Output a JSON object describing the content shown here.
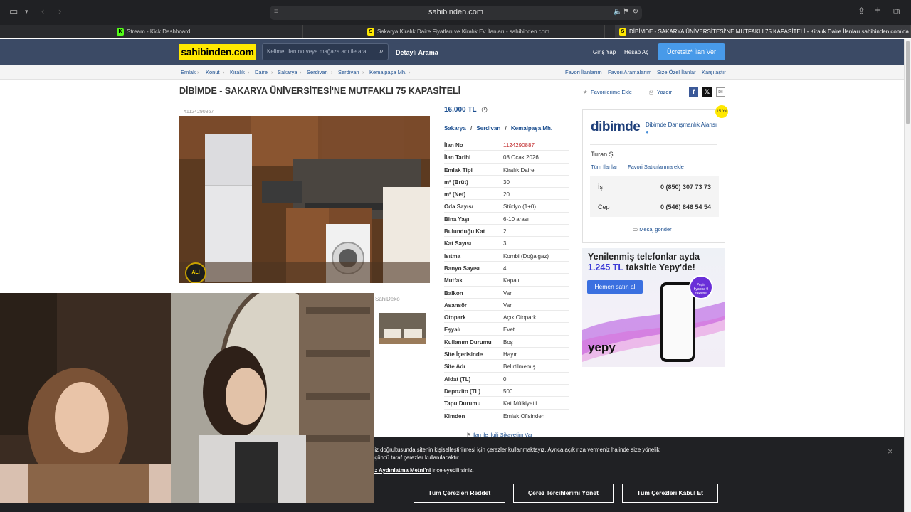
{
  "browser": {
    "url": "sahibinden.com",
    "tabs": [
      {
        "label": "Stream - Kick Dashboard",
        "favicon": "K"
      },
      {
        "label": "Sakarya Kiralık Daire Fiyatları ve Kiralık Ev İlanları - sahibinden.com",
        "favicon": "S"
      },
      {
        "label": "DİBİMDE - SAKARYA ÜNİVERSİTESİ'NE MUTFAKLI 75 KAPASİTELİ - Kiralık Daire İlanları sahibinden.com'da - 1124...",
        "favicon": "S"
      }
    ],
    "icons": [
      "sidebar-icon",
      "back-icon",
      "forward-icon",
      "share-icon",
      "new-tab-icon",
      "tabs-icon"
    ]
  },
  "header": {
    "logo": "sahibinden.com",
    "search_placeholder": "Kelime, ilan no veya mağaza adı ile ara",
    "detailed_search": "Detaylı Arama",
    "login": "Giriş Yap",
    "register": "Hesap Aç",
    "post_ad": "Ücretsiz* İlan Ver"
  },
  "breadcrumb": {
    "items": [
      "Emlak",
      "Konut",
      "Kiralık",
      "Daire",
      "Sakarya",
      "Serdivan",
      "Serdivan",
      "Kemalpaşa Mh."
    ],
    "right_links": [
      "Favori İlanlarım",
      "Favori Aramalarım",
      "Size Özel İlanlar",
      "Karşılaştır"
    ]
  },
  "listing": {
    "title": "DİBİMDE - SAKARYA ÜNİVERSİTESİ'NE MUTFAKLI 75 KAPASİTELİ",
    "add_favorite": "Favorilerime Ekle",
    "print": "Yazdır",
    "photo_id": "#1124290867",
    "price": "16.000 TL",
    "location": {
      "city": "Sakarya",
      "district": "Serdivan",
      "neighborhood": "Kemalpaşa Mh."
    },
    "properties": [
      {
        "key": "İlan No",
        "value": "1124290887"
      },
      {
        "key": "İlan Tarihi",
        "value": "08 Ocak 2026"
      },
      {
        "key": "Emlak Tipi",
        "value": "Kiralık Daire"
      },
      {
        "key": "m² (Brüt)",
        "value": "30"
      },
      {
        "key": "m² (Net)",
        "value": "20"
      },
      {
        "key": "Oda Sayısı",
        "value": "Stüdyo (1+0)"
      },
      {
        "key": "Bina Yaşı",
        "value": "6-10 arası"
      },
      {
        "key": "Bulunduğu Kat",
        "value": "2"
      },
      {
        "key": "Kat Sayısı",
        "value": "3"
      },
      {
        "key": "Isıtma",
        "value": "Kombi (Doğalgaz)"
      },
      {
        "key": "Banyo Sayısı",
        "value": "4"
      },
      {
        "key": "Mutfak",
        "value": "Kapalı"
      },
      {
        "key": "Balkon",
        "value": "Var"
      },
      {
        "key": "Asansör",
        "value": "Var"
      },
      {
        "key": "Otopark",
        "value": "Açık Otopark"
      },
      {
        "key": "Eşyalı",
        "value": "Evet"
      },
      {
        "key": "Kullanım Durumu",
        "value": "Boş"
      },
      {
        "key": "Site İçerisinde",
        "value": "Hayır"
      },
      {
        "key": "Site Adı",
        "value": "Belirtilmemiş"
      },
      {
        "key": "Aidat (TL)",
        "value": "0"
      },
      {
        "key": "Depozito (TL)",
        "value": "500"
      },
      {
        "key": "Tapu Durumu",
        "value": "Kat Mülkiyetli"
      },
      {
        "key": "Kimden",
        "value": "Emlak Ofisinden"
      }
    ],
    "report": "İlan ile İlgili Şikayetim Var",
    "sahideko": "SahiDeko"
  },
  "seller": {
    "badge": "15 Yıl",
    "brand": "dibimde",
    "agency": "Dibimde Danışmanlık Ajansı",
    "person": "Turan Ş.",
    "all_ads": "Tüm İlanları",
    "add_fav_seller": "Favori Satıcılarıma ekle",
    "phones": [
      {
        "label": "İş",
        "number": "0 (850) 307 73 73"
      },
      {
        "label": "Cep",
        "number": "0 (546) 846 54 54"
      }
    ],
    "message": "Mesaj gönder"
  },
  "ad": {
    "line1": "Yenilenmiş telefonlar ayda",
    "line2_amount": "1.245 TL",
    "line2_rest": "taksitle Yepy'de!",
    "button": "Hemen satın al",
    "brand": "yepy",
    "badge": "Peşin fiyatına 9 taksitle"
  },
  "cookie": {
    "line1": "niz doğrultusunda sitenin kişiselleştirilmesi için çerezler kullanmaktayız. Ayrıca açık rıza vermeniz halinde size yönelik",
    "line2": "üçüncü taraf çerezler kullanılacaktır.",
    "line3_link": "ez Aydınlatma Metni'ni",
    "line3_rest": "inceleyebilirsiniz.",
    "reject": "Tüm Çerezleri Reddet",
    "manage": "Çerez Tercihlerimi Yönet",
    "accept": "Tüm Çerezleri Kabul Et",
    "close": "×"
  }
}
